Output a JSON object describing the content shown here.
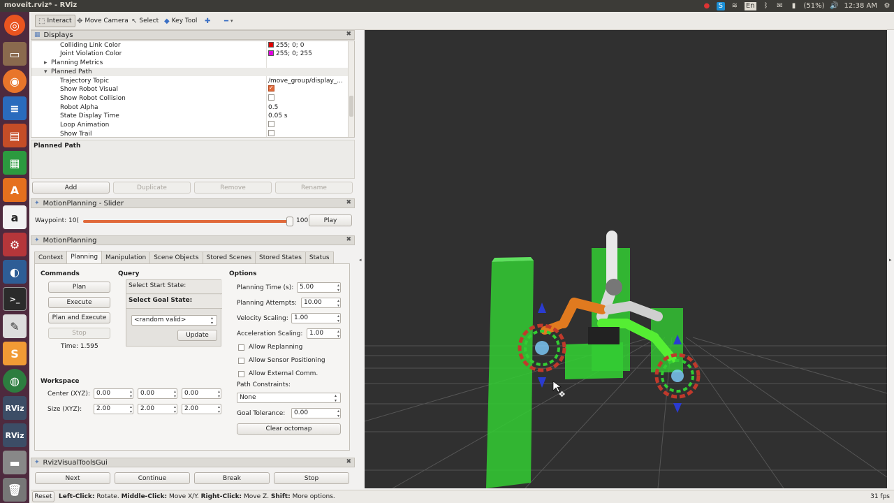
{
  "window": {
    "title": "moveit.rviz* - RViz"
  },
  "tray": {
    "battery": "(51%)",
    "time": "12:38 AM",
    "keyboard": "En"
  },
  "toolbar": {
    "interact": "Interact",
    "move_camera": "Move Camera",
    "select": "Select",
    "key_tool": "Key Tool"
  },
  "displays": {
    "title": "Displays",
    "rows": [
      {
        "name": "Colliding Link Color",
        "value": "255; 0; 0",
        "color": "#e00000"
      },
      {
        "name": "Joint Violation Color",
        "value": "255; 0; 255",
        "color": "#e000e0"
      },
      {
        "name": "Planning Metrics",
        "value": ""
      },
      {
        "name": "Planned Path",
        "value": ""
      },
      {
        "name": "Trajectory Topic",
        "value": "/move_group/display_..."
      },
      {
        "name": "Show Robot Visual",
        "value": ""
      },
      {
        "name": "Show Robot Collision",
        "value": ""
      },
      {
        "name": "Robot Alpha",
        "value": "0.5"
      },
      {
        "name": "State Display Time",
        "value": "0.05 s"
      },
      {
        "name": "Loop Animation",
        "value": ""
      },
      {
        "name": "Show Trail",
        "value": ""
      }
    ],
    "description": "Planned Path",
    "buttons": {
      "add": "Add",
      "duplicate": "Duplicate",
      "remove": "Remove",
      "rename": "Rename"
    }
  },
  "slider_panel": {
    "title": "MotionPlanning - Slider",
    "waypoint_label": "Waypoint:",
    "waypoint_value": "10(",
    "max": "100",
    "play": "Play",
    "progress": 1.0
  },
  "motion_planning": {
    "title": "MotionPlanning",
    "tabs": [
      "Context",
      "Planning",
      "Manipulation",
      "Scene Objects",
      "Stored Scenes",
      "Stored States",
      "Status"
    ],
    "commands": {
      "header": "Commands",
      "plan": "Plan",
      "execute": "Execute",
      "plan_execute": "Plan and Execute",
      "stop": "Stop",
      "time": "Time: 1.595"
    },
    "query": {
      "header": "Query",
      "start": "Select Start State:",
      "goal": "Select Goal State:",
      "goal_value": "<random valid>",
      "update": "Update"
    },
    "options": {
      "header": "Options",
      "planning_time_label": "Planning Time (s):",
      "planning_time": "5.00",
      "planning_attempts_label": "Planning Attempts:",
      "planning_attempts": "10.00",
      "velocity_label": "Velocity Scaling:",
      "velocity": "1.00",
      "accel_label": "Acceleration Scaling:",
      "accel": "1.00",
      "allow_replanning": "Allow Replanning",
      "allow_sensor": "Allow Sensor Positioning",
      "allow_external": "Allow External Comm.",
      "path_constraints": "Path Constraints:",
      "path_constraints_value": "None",
      "goal_tolerance_label": "Goal Tolerance:",
      "goal_tolerance": "0.00",
      "clear_octomap": "Clear octomap"
    },
    "workspace": {
      "header": "Workspace",
      "center_label": "Center (XYZ):",
      "size_label": "Size (XYZ):",
      "center": [
        "0.00",
        "0.00",
        "0.00"
      ],
      "size": [
        "2.00",
        "2.00",
        "2.00"
      ]
    }
  },
  "rvtg": {
    "title": "RvizVisualToolsGui",
    "next": "Next",
    "continue": "Continue",
    "break": "Break",
    "stop": "Stop"
  },
  "status": {
    "reset": "Reset",
    "left": "Left-Click:",
    "left_t": " Rotate. ",
    "middle": "Middle-Click:",
    "middle_t": " Move X/Y. ",
    "right": "Right-Click:",
    "right_t": " Move Z. ",
    "shift": "Shift:",
    "shift_t": " More options.",
    "fps": "31 fps"
  },
  "colors": {
    "accent": "#e0693a",
    "launcher": "#4e2a3e",
    "viewport": "#303030",
    "obstacle": "#33cc33"
  }
}
